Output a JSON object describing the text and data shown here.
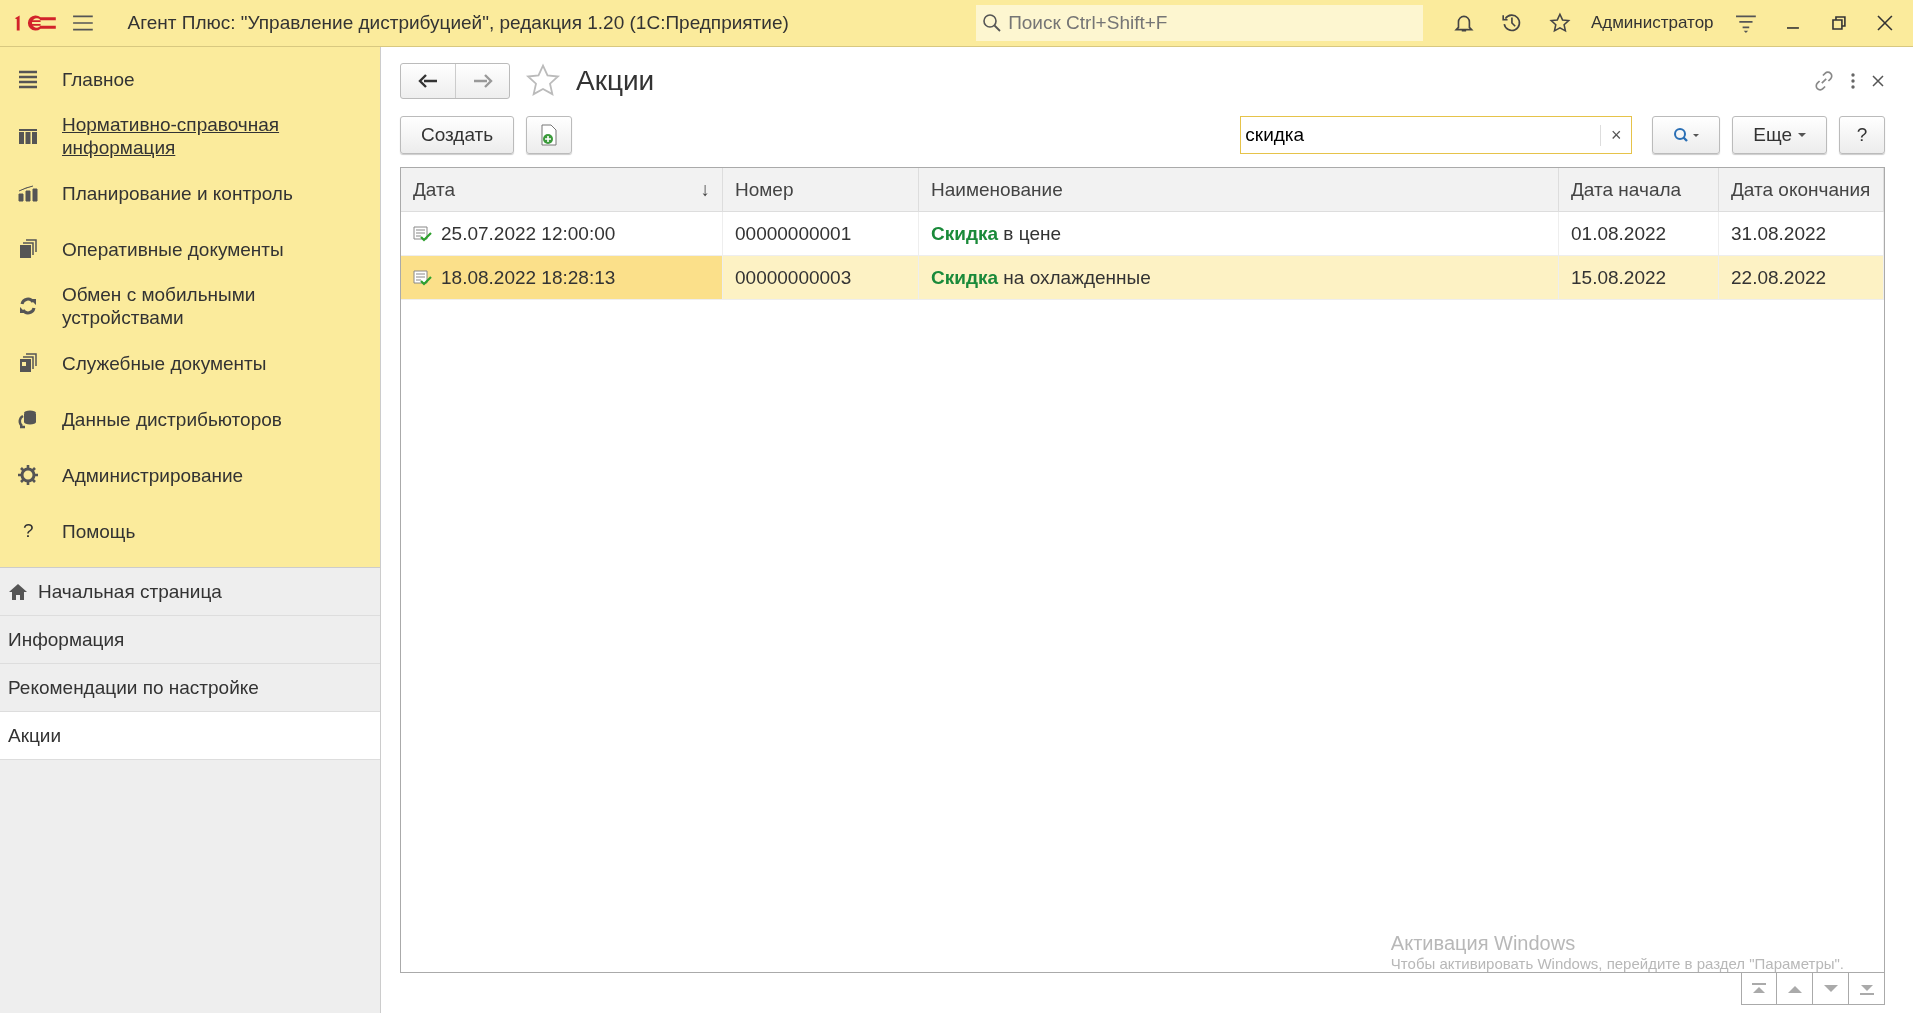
{
  "titlebar": {
    "title": "Агент Плюс: \"Управление дистрибуцией\", редакция 1.20  (1С:Предприятие)",
    "search": {
      "placeholder": "Поиск Ctrl+Shift+F"
    },
    "user": "Администратор"
  },
  "sidebar": {
    "sections": [
      {
        "label": "Главное",
        "kind": "section"
      },
      {
        "label": "Нормативно-справочная информация",
        "kind": "link"
      },
      {
        "label": "Планирование и контроль",
        "kind": "section"
      },
      {
        "label": "Оперативные документы",
        "kind": "section"
      },
      {
        "label": "Обмен с мобильными устройствами",
        "kind": "section"
      },
      {
        "label": "Служебные документы",
        "kind": "section"
      },
      {
        "label": "Данные дистрибьюторов",
        "kind": "section"
      },
      {
        "label": "Администрирование",
        "kind": "section"
      },
      {
        "label": "Помощь",
        "kind": "section",
        "glyph": "?"
      }
    ],
    "open_windows": [
      {
        "label": "Начальная страница",
        "selected": false
      },
      {
        "label": "Информация",
        "selected": false
      },
      {
        "label": "Рекомендации по настройке",
        "selected": false
      },
      {
        "label": "Акции",
        "selected": true
      }
    ]
  },
  "form": {
    "title": "Акции",
    "create_button": "Создать",
    "search": {
      "value": "скидка"
    },
    "clear_glyph": "×",
    "more_button": "Еще",
    "help_button": "?",
    "table": {
      "columns": [
        {
          "label": "Дата",
          "sort": "↓"
        },
        {
          "label": "Номер"
        },
        {
          "label": "Наименование"
        },
        {
          "label": "Дата начала"
        },
        {
          "label": "Дата окончания"
        }
      ],
      "rows": [
        {
          "selected": false,
          "cells": [
            "25.07.2022 12:00:00",
            "00000000001",
            "**Скидка** в цене",
            "01.08.2022",
            "31.08.2022"
          ]
        },
        {
          "selected": true,
          "cells": [
            "18.08.2022 18:28:13",
            "00000000003",
            "**Скидка** на охлажденные",
            "15.08.2022",
            "22.08.2022"
          ]
        }
      ]
    }
  },
  "os_notice": {
    "title": "Активация Windows",
    "text": "Чтобы активировать Windows, перейдите в раздел \"Параметры\"."
  }
}
